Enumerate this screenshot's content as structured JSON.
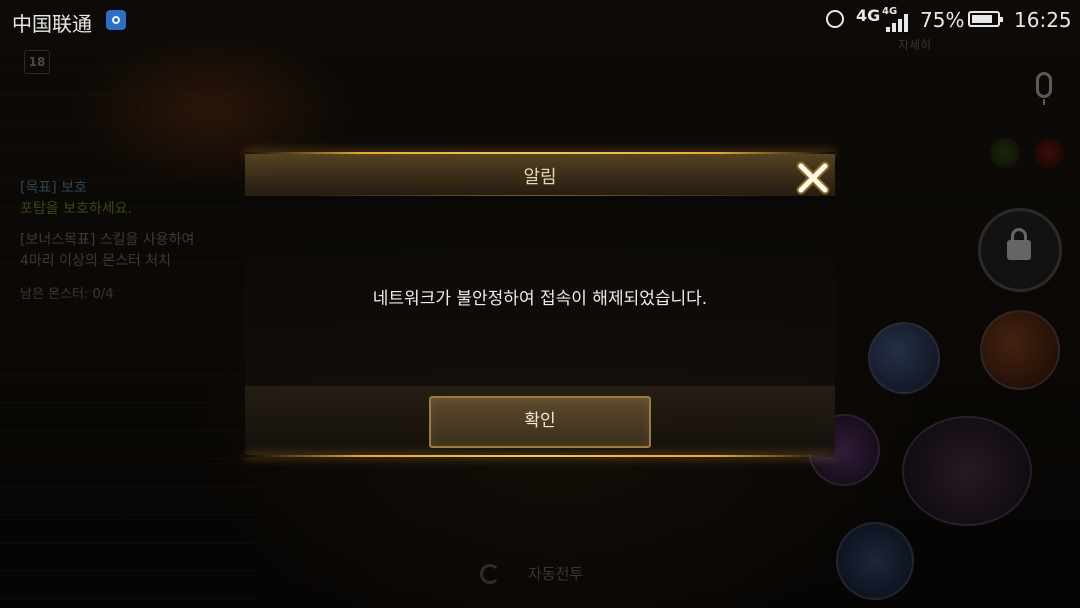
{
  "status_bar": {
    "carrier": "中国联通",
    "network_1": "4G",
    "network_2": "4G",
    "battery_percent": "75%",
    "time": "16:25",
    "icons": [
      "hotspot-icon",
      "alarm-icon",
      "signal-icon",
      "battery-icon"
    ]
  },
  "game_hud": {
    "level": "18",
    "top_right_label": "자세히",
    "quest": {
      "title": "[목표] 보호",
      "description": "포탑을 보호하세요.",
      "bonus_line1": "[보너스목표] 스킬을 사용하여",
      "bonus_line2": "4마리 이상의 몬스터 처치",
      "remaining": "남은 몬스터: 0/4"
    },
    "auto_battle_label": "자동전투",
    "icons": [
      "mic-icon",
      "lock-icon",
      "skill-icon"
    ]
  },
  "dialog": {
    "title": "알림",
    "message": "네트워크가 불안정하여 접속이 해제되었습니다.",
    "confirm_label": "확인",
    "close_icon": "close-icon",
    "accent_color": "#f4c45c"
  }
}
